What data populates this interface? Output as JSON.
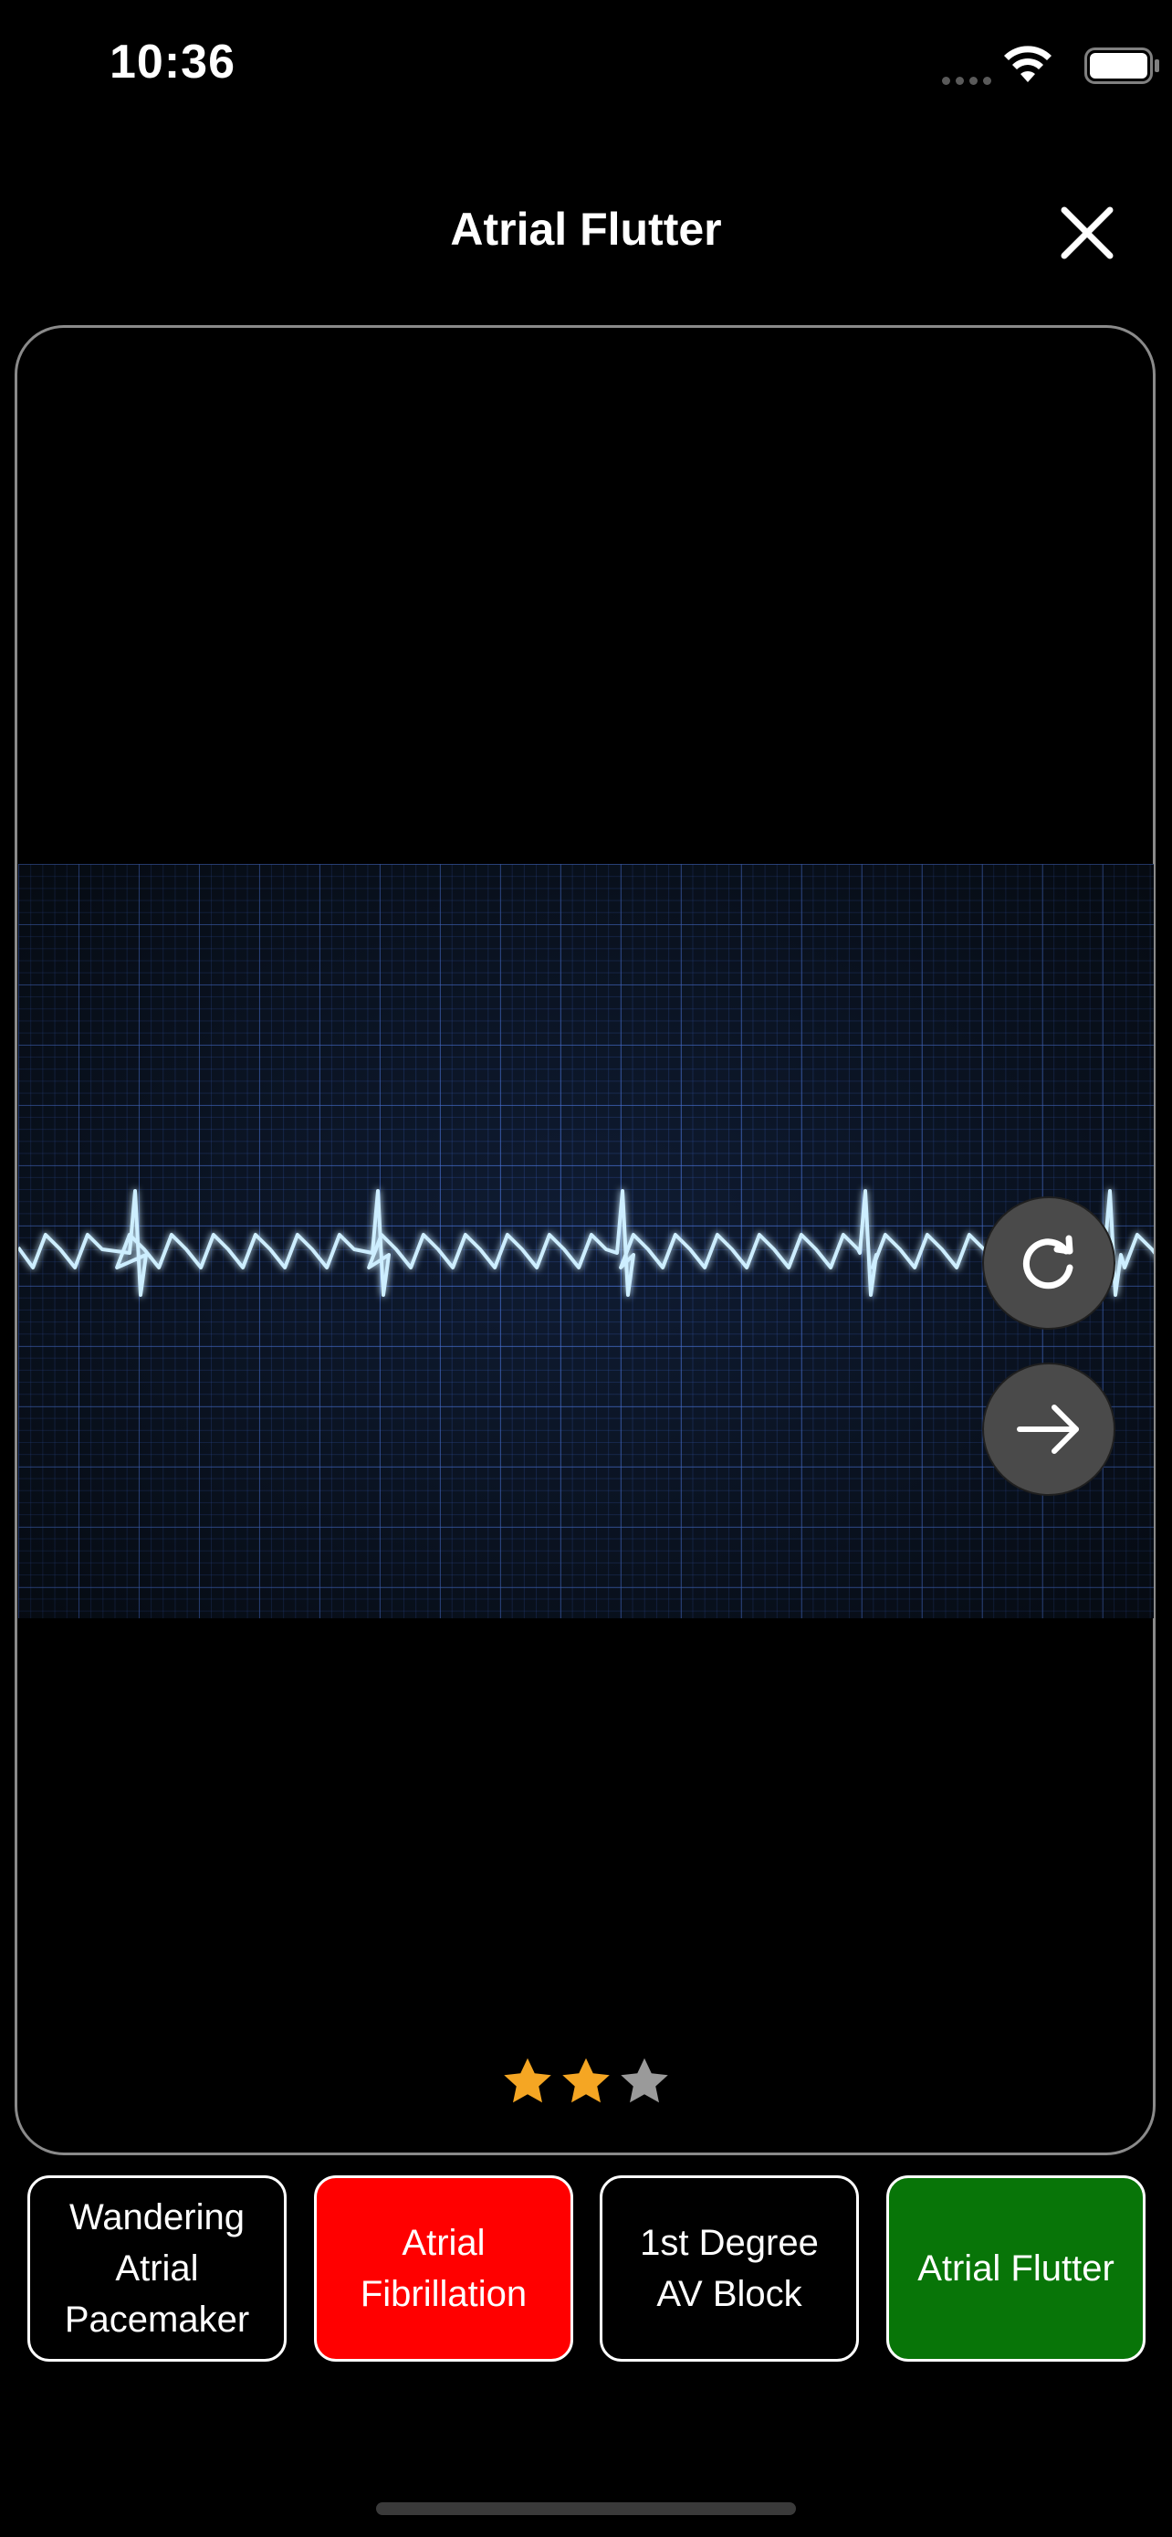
{
  "status_bar": {
    "time": "10:36"
  },
  "header": {
    "title": "Atrial Flutter"
  },
  "rating": {
    "filled": 2,
    "total": 3,
    "filled_color": "#f5a623",
    "empty_color": "#9a9a9a"
  },
  "choices": [
    {
      "label": "Wandering\nAtrial\nPacemaker",
      "bg": "#000000"
    },
    {
      "label": "Atrial\nFibrillation",
      "bg": "#ff0000"
    },
    {
      "label": "1st Degree\nAV Block",
      "bg": "#000000"
    },
    {
      "label": "Atrial Flutter",
      "bg": "#087508"
    }
  ],
  "icons": {
    "close": "close-icon",
    "replay": "replay-icon",
    "next": "arrow-right-icon"
  },
  "colors": {
    "trace": "#cdeeff",
    "grid": "#3c64c8"
  }
}
